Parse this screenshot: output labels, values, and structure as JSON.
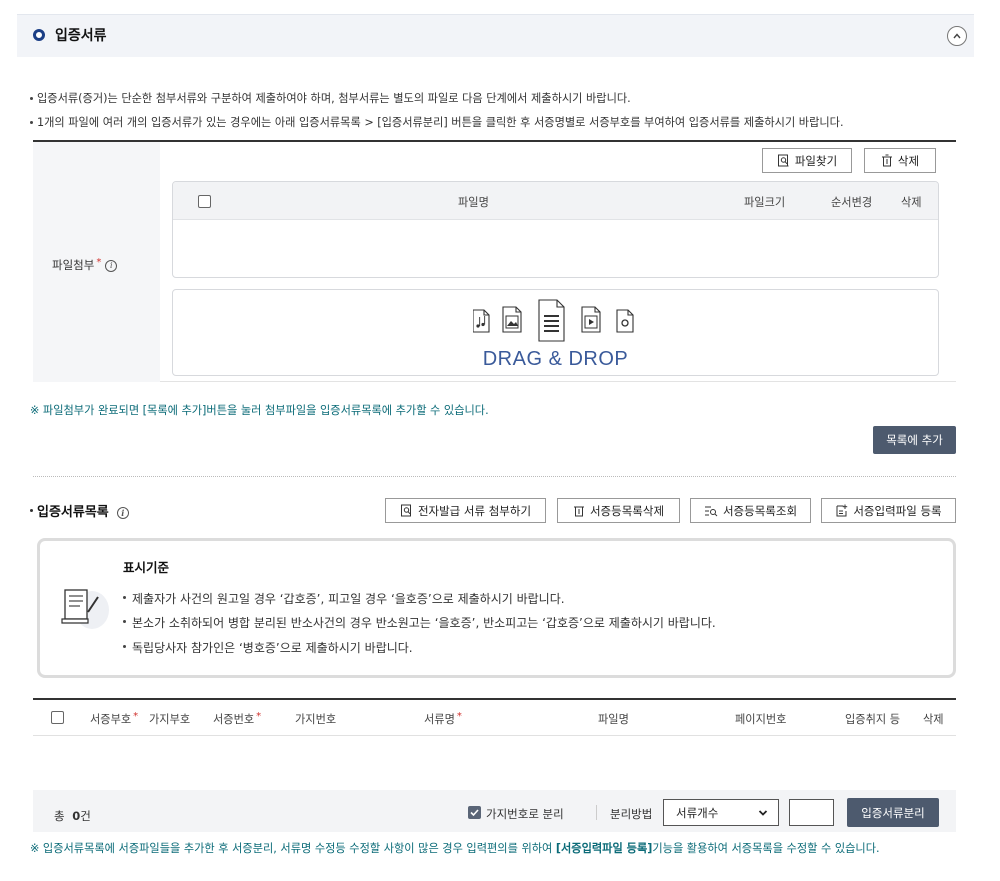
{
  "section": {
    "title": "입증서류"
  },
  "notes": [
    "입증서류(증거)는 단순한 첨부서류와 구분하여 제출하여야 하며, 첨부서류는 별도의 파일로 다음 단계에서 제출하시기 바랍니다.",
    "1개의 파일에 여러 개의 입증서류가 있는 경우에는 아래 입증서류목록 > [입증서류분리] 버튼을 클릭한 후 서증명별로 서증부호를 부여하여 입증서류를 제출하시기 바랍니다."
  ],
  "attach": {
    "label": "파일첨부",
    "find_button": "파일찾기",
    "delete_button": "삭제",
    "columns": {
      "filename": "파일명",
      "filesize": "파일크기",
      "order": "순서변경",
      "delete": "삭제"
    },
    "drop_text": "DRAG & DROP"
  },
  "guide_text": "※ 파일첨부가 완료되면 [목록에 추가]버튼을 눌러 첨부파일을 입증서류목록에 추가할 수 있습니다.",
  "add_to_list_button": "목록에 추가",
  "evidence_list": {
    "title": "입증서류목록",
    "buttons": {
      "e_issue": "전자발급 서류 첨부하기",
      "delete_list": "서증등목록삭제",
      "view_list": "서증등목록조회",
      "register_file": "서증입력파일 등록"
    },
    "criteria": {
      "title": "표시기준",
      "lines": [
        "제출자가 사건의 원고일 경우 ‘갑호증’, 피고일 경우 ‘을호증’으로 제출하시기 바랍니다.",
        "본소가 소취하되어 병합 분리된 반소사건의 경우 반소원고는 ‘을호증’, 반소피고는 ‘갑호증’으로 제출하시기 바랍니다.",
        "독립당사자 참가인은 ‘병호증’으로 제출하시기 바랍니다."
      ]
    },
    "columns": {
      "code": "서증부호",
      "branch_code": "가지부호",
      "number": "서증번호",
      "branch_number": "가지번호",
      "doc_name": "서류명",
      "filename": "파일명",
      "page_number": "페이지번호",
      "cancel": "입증취지 등",
      "delete": "삭제"
    },
    "footer": {
      "total_prefix": "총",
      "total_count": "0",
      "total_suffix": "건",
      "branch_split_label": "가지번호로 분리",
      "split_method_label": "분리방법",
      "split_method_value": "서류개수",
      "split_button": "입증서류분리"
    }
  },
  "bottom_note": {
    "before": "※ 입증서류목록에 서증파일들을 추가한 후 서증분리, 서류명 수정등 수정할 사항이 많은 경우 입력편의를 위하여 ",
    "highlight": "[서증입력파일 등록]",
    "after": "기능을 활용하여 서증목록을 수정할 수 있습니다."
  },
  "colors": {
    "accent": "#1c3f86",
    "dark_button": "#4d5a6e",
    "guide": "#0b6b78",
    "required": "#d0312d"
  }
}
